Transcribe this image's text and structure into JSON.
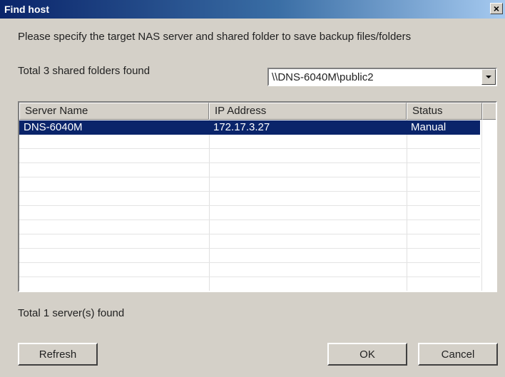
{
  "window": {
    "title": "Find host",
    "close_glyph": "×"
  },
  "instruction": "Please specify the target NAS server and shared folder to save backup files/folders",
  "folders": {
    "total_label": "Total 3 shared folders found",
    "selected": "\\\\DNS-6040M\\public2"
  },
  "table": {
    "columns": [
      "Server Name",
      "IP Address",
      "Status"
    ],
    "rows": [
      {
        "server_name": "DNS-6040M",
        "ip_address": "172.17.3.27",
        "status": "Manual",
        "selected": true
      }
    ]
  },
  "servers": {
    "total_label": "Total 1 server(s) found"
  },
  "buttons": {
    "refresh": "Refresh",
    "ok": "OK",
    "cancel": "Cancel"
  },
  "colors": {
    "selection": "#0a246a",
    "dialog_bg": "#d4d0c8"
  }
}
